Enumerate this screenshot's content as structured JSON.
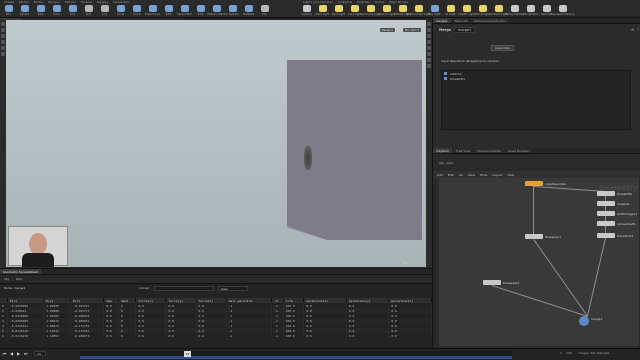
{
  "shelf": {
    "tabs_left": [
      "Create",
      "Modify",
      "Model",
      "Polygon",
      "Deform",
      "Texture",
      "Rigging",
      "Characters"
    ],
    "tabs_right": [
      "Lights and Cameras",
      "Collisions",
      "Particles",
      "Grains",
      "Rigid Bodies"
    ],
    "tools_left": [
      {
        "label": "Box",
        "color": "#7aa0d6"
      },
      {
        "label": "Sphere",
        "color": "#7aa0d6"
      },
      {
        "label": "Tube",
        "color": "#7aa0d6"
      },
      {
        "label": "Torus",
        "color": "#7aa0d6"
      },
      {
        "label": "Grid",
        "color": "#7aa0d6"
      },
      {
        "label": "Null",
        "color": "#b6b6b6"
      },
      {
        "label": "Line",
        "color": "#b6b6b6"
      },
      {
        "label": "Circle",
        "color": "#7aa0d6"
      },
      {
        "label": "Curve",
        "color": "#7aa0d6"
      },
      {
        "label": "Draw Curve",
        "color": "#7aa0d6"
      },
      {
        "label": "Path",
        "color": "#7aa0d6"
      },
      {
        "label": "Spray Paint",
        "color": "#7aa0d6"
      },
      {
        "label": "Font",
        "color": "#7aa0d6"
      },
      {
        "label": "Platonic Solids",
        "color": "#7aa0d6"
      },
      {
        "label": "L-System",
        "color": "#7aa0d6"
      },
      {
        "label": "Metaball",
        "color": "#7aa0d6"
      },
      {
        "label": "File",
        "color": "#b6b6b6"
      }
    ],
    "tools_right": [
      {
        "label": "Camera",
        "color": "#c8c8c8"
      },
      {
        "label": "Point Light",
        "color": "#e8d36a"
      },
      {
        "label": "Spot Light",
        "color": "#e8d36a"
      },
      {
        "label": "Area Light",
        "color": "#e8d36a"
      },
      {
        "label": "Geometry Light",
        "color": "#e8d36a"
      },
      {
        "label": "Volume Light",
        "color": "#e8d36a"
      },
      {
        "label": "Distant Light",
        "color": "#e8d36a"
      },
      {
        "label": "Environment Light",
        "color": "#e8d36a"
      },
      {
        "label": "Sky Light",
        "color": "#7aa0d6"
      },
      {
        "label": "GI Light",
        "color": "#e8d36a"
      },
      {
        "label": "Caustic Light",
        "color": "#e8d36a"
      },
      {
        "label": "Portal Light",
        "color": "#e8d36a"
      },
      {
        "label": "Ambient Light",
        "color": "#e8d36a"
      },
      {
        "label": "Stereo Camera",
        "color": "#c8c8c8"
      },
      {
        "label": "VR Camera",
        "color": "#c8c8c8"
      },
      {
        "label": "Switcher",
        "color": "#c8c8c8"
      },
      {
        "label": "Gamepad Camera",
        "color": "#c8c8c8"
      }
    ]
  },
  "left_tabs": [
    "Scene View",
    "Animation Editor",
    "Render View",
    "Composite View",
    "Motion FX View",
    "Geometry Spreadsheet"
  ],
  "viewport": {
    "pane_label": "View",
    "path": [
      "obj",
      "zoro"
    ],
    "persp_label": "Persp ▾",
    "cam_label": "No cam ▾",
    "corner_text": "Box"
  },
  "spreadsheet": {
    "tab_label": "Geometry Spreadsheet",
    "path": [
      "obj",
      "zoro"
    ],
    "node_label": "Node: merge1",
    "group_label": "Group:",
    "view_label": "View",
    "columns": [
      "",
      "P[x]",
      "P[y]",
      "P[z]",
      "age",
      "dead",
      "force[x]",
      "force[y]",
      "force[z]",
      "hair_parentid",
      "id",
      "life",
      "pprevious[x]",
      "pprevious[y]",
      "pprevious[z]"
    ],
    "rows": [
      [
        "0",
        "-0.0250999",
        "1.00905",
        "-0.185921",
        "0.0",
        "0",
        "0.0",
        "0.0",
        "0.0",
        "-1",
        "-1",
        "100.0",
        "0.0",
        "0.0",
        "0.0"
      ],
      [
        "1",
        "-0.038491",
        "1.00888",
        "-0.181771",
        "0.0",
        "0",
        "0.0",
        "0.0",
        "0.0",
        "-1",
        "-1",
        "100.0",
        "0.0",
        "0.0",
        "0.0"
      ],
      [
        "2",
        "-0.0226929",
        "1.00905",
        "-0.186833",
        "0.0",
        "0",
        "0.0",
        "0.0",
        "0.0",
        "-1",
        "-1",
        "100.0",
        "0.0",
        "0.0",
        "0.0"
      ],
      [
        "3",
        "-0.0305999",
        "1.00913",
        "-0.186931",
        "0.0",
        "0",
        "0.0",
        "0.0",
        "0.0",
        "-1",
        "-1",
        "100.0",
        "0.0",
        "0.0",
        "0.0"
      ],
      [
        "4",
        "-0.0167611",
        "1.00879",
        "-0.174752",
        "0.0",
        "0",
        "0.0",
        "0.0",
        "0.0",
        "-1",
        "-1",
        "100.0",
        "0.0",
        "0.0",
        "0.0"
      ],
      [
        "5",
        "-0.0126119",
        "1.10521",
        "-0.171257",
        "0.0",
        "0",
        "0.0",
        "0.0",
        "0.0",
        "-1",
        "-1",
        "100.0",
        "0.0",
        "0.0",
        "0.0"
      ],
      [
        "6",
        "-0.0116219",
        "1.10053",
        "-0.188973",
        "0.0",
        "0",
        "0.0",
        "0.0",
        "0.0",
        "-1",
        "-1",
        "100.0",
        "0.0",
        "0.0",
        "0.0"
      ]
    ]
  },
  "right_tabs": [
    "merge1",
    "Take List",
    "Performance Monitor"
  ],
  "params": {
    "node_type": "Merge",
    "node_name": "merge1",
    "assemble_label": "Assemble",
    "input_header": "Input Operators (Drag/Drop to reorder)",
    "inputs": [
      "switch1",
      "timeshift1"
    ]
  },
  "network": {
    "tabs": [
      "/obj/zoro",
      "Tree View",
      "Material Palette",
      "Asset Browser"
    ],
    "path": [
      "obj",
      "zoro"
    ],
    "menu": [
      "Add",
      "Edit",
      "Go",
      "View",
      "Tools",
      "Layout",
      "Help"
    ],
    "title": "Geometry",
    "nodes": [
      {
        "label": "copytopoints1",
        "color": "#e8a03a"
      },
      {
        "label": "timeshift1",
        "color": "#c9c9c9"
      },
      {
        "label": "unpack1",
        "color": "#c9c9c9"
      },
      {
        "label": "addfromgeo1",
        "color": "#c9c9c9"
      },
      {
        "label": "convertself1",
        "color": "#c9c9c9"
      },
      {
        "label": "transform1",
        "color": "#c9c9c9"
      },
      {
        "label": "timewarp1",
        "color": "#c9c9c9"
      },
      {
        "label": "timewarp2",
        "color": "#c9c9c9"
      },
      {
        "label": "merge1",
        "color": "#c9c9c9"
      }
    ]
  },
  "timeline": {
    "frame": "24",
    "start": "1",
    "end": "240",
    "status": "0 keys, 0/0 channels"
  }
}
